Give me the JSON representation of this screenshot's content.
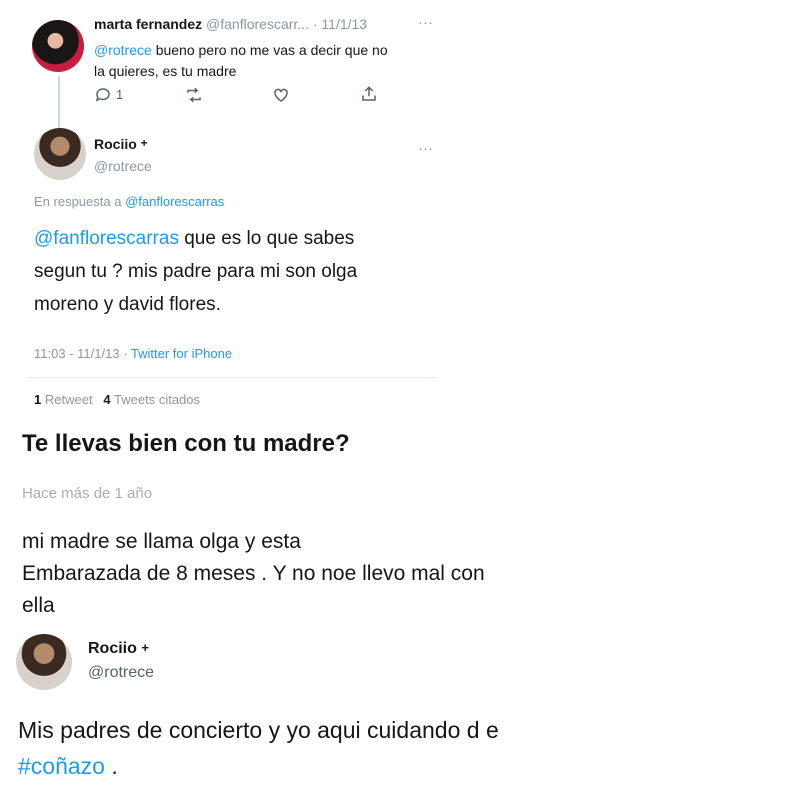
{
  "tweet1": {
    "name": "marta fernandez",
    "handle": "@fanflorescarr...",
    "separator": "·",
    "date": "11/1/13",
    "more": "···",
    "mention": "@rotrece",
    "text_line1": "bueno pero no me vas a decir que no",
    "text_line2": "la quieres, es tu madre",
    "reply_count": "1"
  },
  "tweet2": {
    "name": "Rociio",
    "badge": "+",
    "handle": "@rotrece",
    "more": "···",
    "reply_to_prefix": "En respuesta a",
    "reply_to_handle": "@fanflorescarras",
    "mention": "@fanflorescarras",
    "text_line1_rest": " que es lo que sabes",
    "text_line2": "segun tu ? mis padre para mi son olga",
    "text_line3": "moreno y david flores.",
    "timestamp": "11:03 - 11/1/13",
    "dot": "·",
    "source": "Twitter for iPhone",
    "retweets_count": "1",
    "retweets_label": "Retweet",
    "quotes_count": "4",
    "quotes_label": "Tweets citados"
  },
  "question": {
    "title": "Te llevas bien con tu madre?",
    "time": "Hace más de 1 año",
    "answer_line1": "mi madre se llama olga y esta",
    "answer_line2": "Embarazada de 8 meses . Y no noe llevo mal con",
    "answer_line3": "ella"
  },
  "tweet3": {
    "name": "Rociio",
    "badge": "+",
    "handle": "@rotrece",
    "text_line1": "Mis padres de concierto y yo aqui cuidando d e",
    "hashtag": "#coñazo",
    "text_end": " ."
  },
  "colors": {
    "link": "#1d9bf0",
    "muted": "#8b98a5",
    "text": "#14171a"
  }
}
